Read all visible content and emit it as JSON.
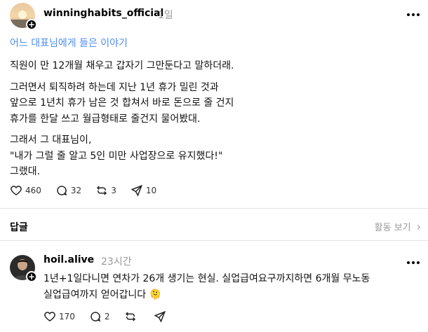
{
  "post": {
    "username": "winninghabits_official",
    "timestamp": "1일",
    "topic": "어느 대표님에게 들은 이야기",
    "lines": [
      "직원이 만 12개월 채우고 갑자기 그만둔다고 말하더래.",
      "그러면서 퇴직하려 하는데 지난 1년 휴가 밀린 것과",
      "앞으로 1년치 휴가 남은 것 합쳐서 바로 돈으로 줄 건지",
      "휴가를 한달 쓰고 월급형태로 줄건지 물어봤대.",
      "그래서 그 대표님이,",
      "\"내가 그럴 줄 알고 5인 미만 사업장으로 유지했다!\"",
      "그랬대."
    ],
    "likes": "460",
    "comments": "32",
    "reposts": "3",
    "shares": "10"
  },
  "replies_header": {
    "title": "답글",
    "activity_label": "활동 보기"
  },
  "reply": {
    "username": "hoil.alive",
    "timestamp": "23시간",
    "lines": [
      "1년+1일다니면 연차가 26개 생기는 현실. 실업급여요구까지하면 6개월 무노동",
      "실업급여까지 얻어갑니다"
    ],
    "emoji": "🫠",
    "likes": "170",
    "comments": "2",
    "reposts": "",
    "shares": ""
  },
  "colors": {
    "topic": "#4f8ef2",
    "muted": "#999999",
    "divider": "#e5e5e5"
  }
}
